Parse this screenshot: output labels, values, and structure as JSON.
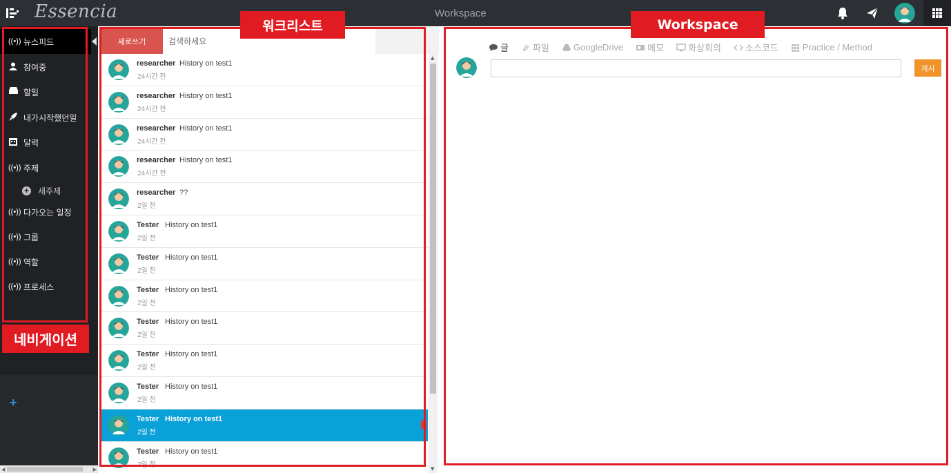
{
  "topbar": {
    "brand": "Essencia",
    "title": "Workspace",
    "icons": [
      "menu-toggle-icon",
      "bell-icon",
      "paper-plane-icon",
      "user-avatar",
      "apps-grid-icon"
    ]
  },
  "sidebar": {
    "items": [
      {
        "label": "뉴스피드",
        "icon": "broadcast-icon",
        "active": true
      },
      {
        "label": "참여중",
        "icon": "user-icon"
      },
      {
        "label": "할일",
        "icon": "inbox-icon"
      },
      {
        "label": "내가시작했던일",
        "icon": "rocket-icon"
      },
      {
        "label": "달력",
        "icon": "calendar-icon"
      },
      {
        "label": "주제",
        "icon": "broadcast-icon"
      },
      {
        "label": "다가오는 일정",
        "icon": "broadcast-icon"
      },
      {
        "label": "그룹",
        "icon": "broadcast-icon"
      },
      {
        "label": "역할",
        "icon": "broadcast-icon"
      },
      {
        "label": "프로세스",
        "icon": "broadcast-icon"
      }
    ],
    "sub_item": {
      "label": "새주제",
      "icon": "plus-circle-icon"
    },
    "add_label": "+"
  },
  "worklist": {
    "new_button": "새로쓰기",
    "search_placeholder": "검색하세요",
    "items": [
      {
        "author": "researcher",
        "subject": "History on test1",
        "time": "24시간 전"
      },
      {
        "author": "researcher",
        "subject": "History on test1",
        "time": "24시간 전"
      },
      {
        "author": "researcher",
        "subject": "History on test1",
        "time": "24시간 전"
      },
      {
        "author": "researcher",
        "subject": "History on test1",
        "time": "24시간 전"
      },
      {
        "author": "researcher",
        "subject": "??",
        "time": "2일 전"
      },
      {
        "author": "Tester",
        "subject": "History on test1",
        "time": "2일 전"
      },
      {
        "author": "Tester",
        "subject": "History on test1",
        "time": "2일 전"
      },
      {
        "author": "Tester",
        "subject": "History on test1",
        "time": "2일 전"
      },
      {
        "author": "Tester",
        "subject": "History on test1",
        "time": "2일 전"
      },
      {
        "author": "Tester",
        "subject": "History on test1",
        "time": "2일 전"
      },
      {
        "author": "Tester",
        "subject": "History on test1",
        "time": "2일 전"
      },
      {
        "author": "Tester",
        "subject": "History on test1",
        "time": "2일 전",
        "selected": true
      },
      {
        "author": "Tester",
        "subject": "History on test1",
        "time": "2일 전"
      }
    ]
  },
  "workspace": {
    "tabs": [
      {
        "label": "글",
        "icon": "comment-icon",
        "active": true
      },
      {
        "label": "파일",
        "icon": "paperclip-icon"
      },
      {
        "label": "GoogleDrive",
        "icon": "google-drive-icon"
      },
      {
        "label": "메모",
        "icon": "memo-icon"
      },
      {
        "label": "화상회의",
        "icon": "monitor-icon"
      },
      {
        "label": "소스코드",
        "icon": "code-icon"
      },
      {
        "label": "Practice / Method",
        "icon": "grid-icon"
      }
    ],
    "post_button": "게시"
  },
  "annotations": {
    "navigation": "네비게이션",
    "worklist": "워크리스트",
    "workspace": "Workspace"
  },
  "colors": {
    "topbar": "#2c2f33",
    "sidebar": "#1f2124",
    "new_button": "#d9534f",
    "selected_row": "#0aa0d8",
    "post_button": "#f0932b",
    "annotation": "#e11b22",
    "avatar": "#26a69a"
  }
}
